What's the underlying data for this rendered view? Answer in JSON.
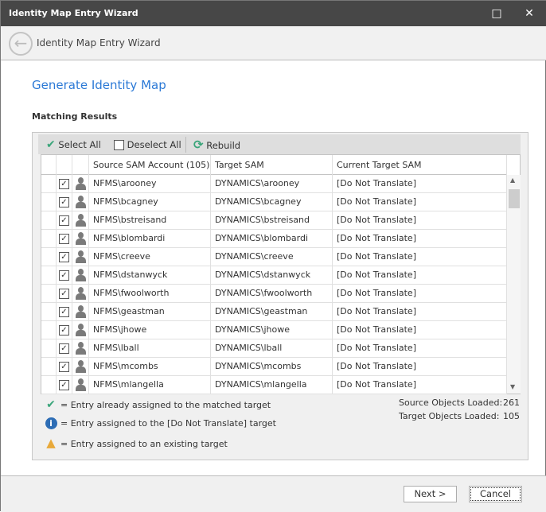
{
  "window": {
    "title": "Identity Map Entry Wizard",
    "maximize_icon": "□",
    "close_icon": "✕"
  },
  "header": {
    "title": "Identity Map Entry Wizard",
    "back_icon": "←"
  },
  "page_title": "Generate Identity Map",
  "section_title": "Matching Results",
  "toolbar": {
    "select_all": "Select All",
    "deselect_all": "Deselect All",
    "rebuild": "Rebuild"
  },
  "grid": {
    "columns": [
      "Source SAM Account (105)",
      "Target SAM",
      "Current Target SAM"
    ],
    "rows": [
      {
        "source": "NFMS\\arooney",
        "target": "DYNAMICS\\arooney",
        "current": "[Do Not Translate]"
      },
      {
        "source": "NFMS\\bcagney",
        "target": "DYNAMICS\\bcagney",
        "current": "[Do Not Translate]"
      },
      {
        "source": "NFMS\\bstreisand",
        "target": "DYNAMICS\\bstreisand",
        "current": "[Do Not Translate]"
      },
      {
        "source": "NFMS\\blombardi",
        "target": "DYNAMICS\\blombardi",
        "current": "[Do Not Translate]"
      },
      {
        "source": "NFMS\\creeve",
        "target": "DYNAMICS\\creeve",
        "current": "[Do Not Translate]"
      },
      {
        "source": "NFMS\\dstanwyck",
        "target": "DYNAMICS\\dstanwyck",
        "current": "[Do Not Translate]"
      },
      {
        "source": "NFMS\\fwoolworth",
        "target": "DYNAMICS\\fwoolworth",
        "current": "[Do Not Translate]"
      },
      {
        "source": "NFMS\\geastman",
        "target": "DYNAMICS\\geastman",
        "current": "[Do Not Translate]"
      },
      {
        "source": "NFMS\\jhowe",
        "target": "DYNAMICS\\jhowe",
        "current": "[Do Not Translate]"
      },
      {
        "source": "NFMS\\lball",
        "target": "DYNAMICS\\lball",
        "current": "[Do Not Translate]"
      },
      {
        "source": "NFMS\\mcombs",
        "target": "DYNAMICS\\mcombs",
        "current": "[Do Not Translate]"
      },
      {
        "source": "NFMS\\mlangella",
        "target": "DYNAMICS\\mlangella",
        "current": "[Do Not Translate]"
      }
    ]
  },
  "legend": [
    "= Entry already assigned to the matched target",
    "= Entry assigned to the [Do Not Translate] target",
    "= Entry assigned to an existing target"
  ],
  "stats": {
    "source_label": "Source Objects Loaded:",
    "source_value": "261",
    "target_label": "Target Objects Loaded:",
    "target_value": "105"
  },
  "footer": {
    "next": "Next >",
    "cancel": "Cancel"
  },
  "colors": {
    "accent": "#2b79d6",
    "titlebar": "#474747",
    "check": "#3aa57a"
  }
}
